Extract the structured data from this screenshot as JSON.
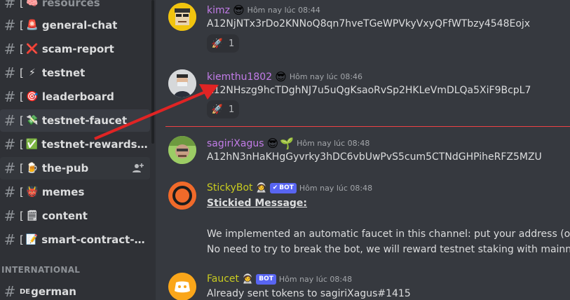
{
  "sidebar": {
    "channels": [
      {
        "label": "resources",
        "emoji": "🧠",
        "muted": true
      },
      {
        "label": "general-chat",
        "emoji": "🚨",
        "muted": false
      },
      {
        "label": "scam-report",
        "emoji": "❌",
        "muted": false
      },
      {
        "label": "testnet",
        "emoji": "⚡",
        "muted": false
      },
      {
        "label": "leaderboard",
        "emoji": "🎯",
        "muted": false
      },
      {
        "label": "testnet-faucet",
        "emoji": "💸",
        "muted": false
      },
      {
        "label": "testnet-rewards-...",
        "emoji": "✅",
        "muted": false
      },
      {
        "label": "the-pub",
        "emoji": "🍺",
        "muted": false
      },
      {
        "label": "memes",
        "emoji": "👹",
        "muted": false
      },
      {
        "label": "content",
        "emoji": "🗒",
        "muted": false
      },
      {
        "label": "smart-contract-e...",
        "emoji": "📝",
        "muted": false
      },
      {
        "label": "german",
        "emoji": "",
        "muted": false
      }
    ],
    "bracket": "[",
    "category_label": "INTERNATIONAL",
    "german_prefix": "DE"
  },
  "messages": [
    {
      "author": "kimz",
      "author_color": "#c27ce8",
      "time": "Hôm nay lúc 08:44",
      "text": "A12NjNTx3rDo2KNNoQ8qn7hveTGeWPVkyVxyQFfWTbzy4548Eojx",
      "reaction": "🚀",
      "reaction_count": "1"
    },
    {
      "author": "kiemthu1802",
      "author_color": "#c27ce8",
      "time": "Hôm nay lúc 08:46",
      "text": "A12NHszg9hcTDghNJ7u5uQgKsaoRvSp2HKLeVmDLQa5XiF9BcpL7",
      "reaction": "🚀",
      "reaction_count": "1"
    },
    {
      "author": "sagiriXagus",
      "author_color": "#c27ce8",
      "time": "Hôm nay lúc 08:48",
      "text": "A12hN3nHaKHgGyvrky3hDC6vbUwPvS5cum5CTNdGHPiheRFZ5MZU"
    },
    {
      "author": "StickyBot",
      "author_color": "#c9cc1f",
      "bot_label": "BOT",
      "time": "Hôm nay lúc 08:48",
      "title": "Stickied Message:",
      "line1": "We implemented an automatic faucet in this channel: put your address (only yo",
      "line2": "No need to try to break the bot, we will reward testnet staking with mainnet M"
    },
    {
      "author": "Faucet",
      "author_color": "#c9cc1f",
      "bot_label": "BOT",
      "time": "Hôm nay lúc 08:48",
      "text": "Already sent tokens to sagiriXagus#1415"
    }
  ],
  "colors": {
    "accent_red": "#ed4245",
    "blurple": "#5865f2"
  }
}
